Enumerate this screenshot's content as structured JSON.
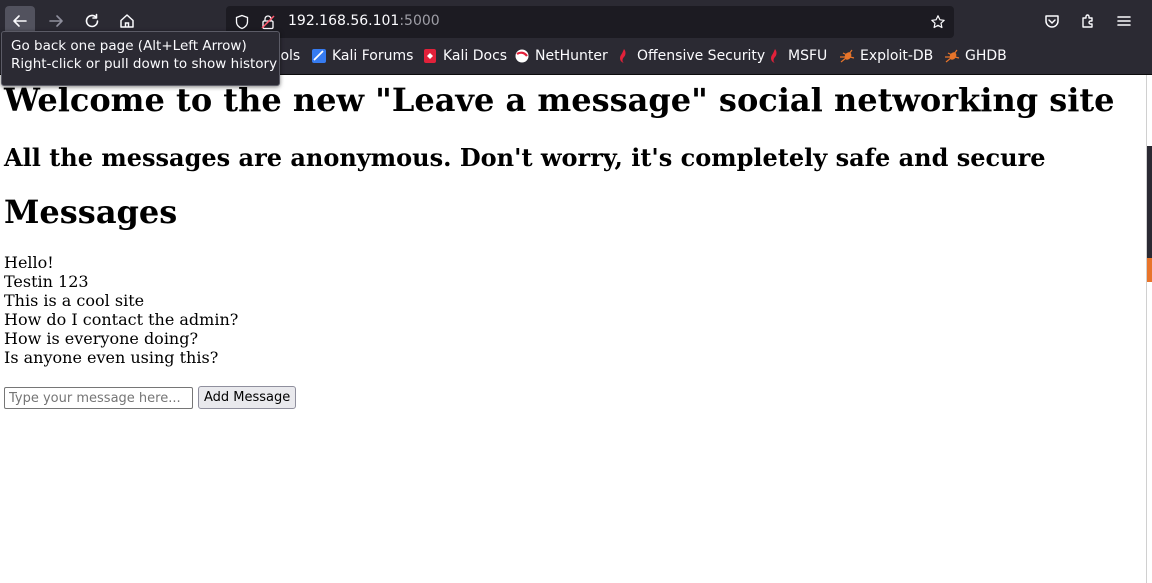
{
  "browser": {
    "url_host": "192.168.56.101",
    "url_port": ":5000",
    "tooltip_line1": "Go back one page (Alt+Left Arrow)",
    "tooltip_line2": "Right-click or pull down to show history",
    "bookmarks": [
      "Kali Tools",
      "Kali Forums",
      "Kali Docs",
      "NetHunter",
      "Offensive Security",
      "MSFU",
      "Exploit-DB",
      "GHDB"
    ]
  },
  "page": {
    "title": "Welcome to the new \"Leave a message\" social networking site",
    "subtitle": "All the messages are anonymous. Don't worry, it's completely safe and secure",
    "messages_heading": "Messages",
    "messages": [
      "Hello!",
      "Testin 123",
      "This is a cool site",
      "How do I contact the admin?",
      "How is everyone doing?",
      "Is anyone even using this?"
    ],
    "input_placeholder": "Type your message here...",
    "add_button": "Add Message"
  }
}
